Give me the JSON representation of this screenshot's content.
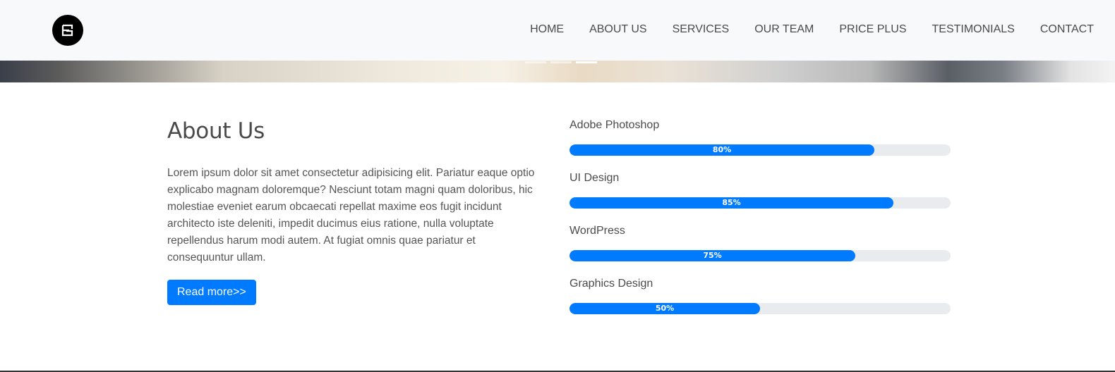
{
  "brand": {
    "logo_letter": "E",
    "logo_icon": "brand-logo-icon",
    "logo_color": "#000000"
  },
  "nav": {
    "items": [
      {
        "label": "HOME"
      },
      {
        "label": "ABOUT US"
      },
      {
        "label": "SERVICES"
      },
      {
        "label": "OUR TEAM"
      },
      {
        "label": "PRICE PLUS"
      },
      {
        "label": "TESTIMONIALS"
      },
      {
        "label": "CONTACT"
      }
    ]
  },
  "carousel": {
    "slide_count": 3,
    "active_index": 2
  },
  "about": {
    "title": "About Us",
    "body": "Lorem ipsum dolor sit amet consectetur adipisicing elit. Pariatur eaque optio\nexplicabo magnam doloremque? Nesciunt totam magni quam doloribus, hic\nmolestiae eveniet earum obcaecati repellat maxime eos fugit incidunt\narchitecto iste deleniti, impedit ducimus eius ratione, nulla voluptate\nrepellendus harum modi autem. At fugiat omnis quae pariatur et\nconsequuntur ullam.",
    "button_label": "Read more>>"
  },
  "skills": [
    {
      "label": "Adobe Photoshop",
      "percent": 80,
      "percent_label": "80%"
    },
    {
      "label": "UI Design",
      "percent": 85,
      "percent_label": "85%"
    },
    {
      "label": "WordPress",
      "percent": 75,
      "percent_label": "75%"
    },
    {
      "label": "Graphics Design",
      "percent": 50,
      "percent_label": "50%"
    }
  ],
  "colors": {
    "accent": "#007bff",
    "navbar_bg": "#f8f9fa",
    "track": "#e9ecef"
  }
}
